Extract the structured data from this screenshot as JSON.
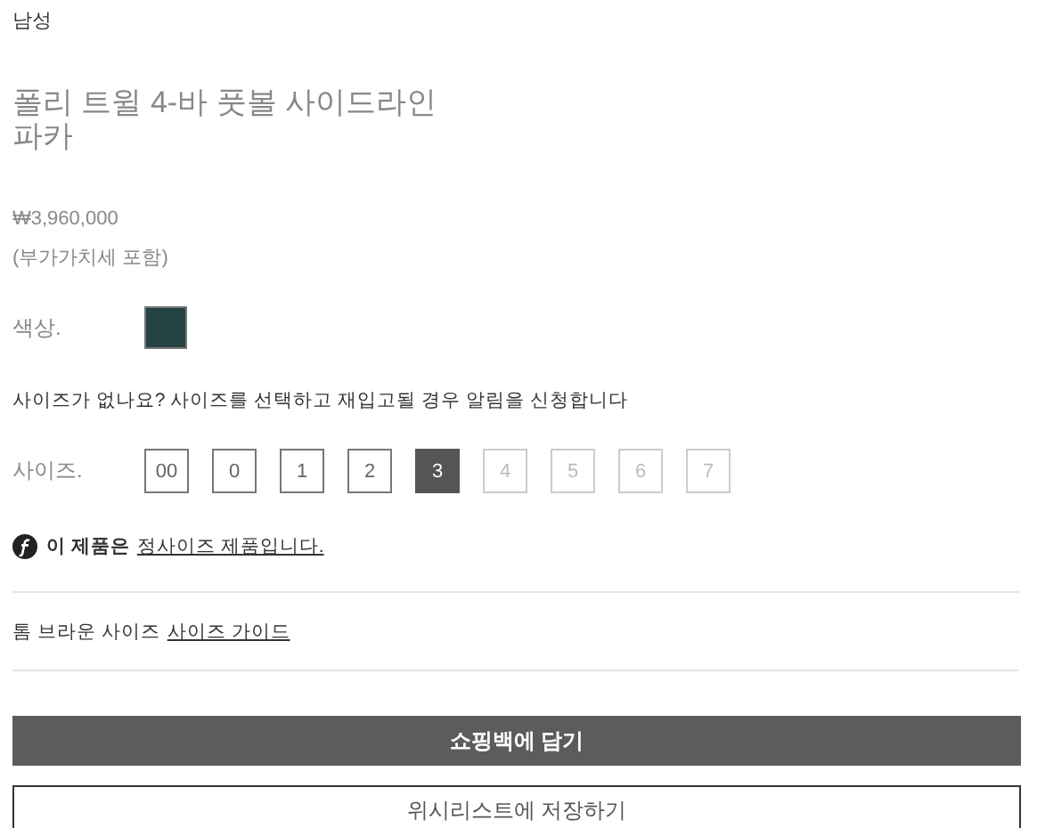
{
  "category": "남성",
  "title_lines": [
    "폴리 트윌 4-바 풋볼 사이드라인",
    "파카"
  ],
  "price": "₩3,960,000",
  "vat_note": "(부가가치세 포함)",
  "color": {
    "label": "색상.",
    "swatches": [
      {
        "color": "#244443",
        "selected": true
      }
    ]
  },
  "size_notice": "사이즈가 없나요? 사이즈를 선택하고 재입고될 경우 알림을 신청합니다",
  "size": {
    "label": "사이즈.",
    "options": [
      {
        "label": "00",
        "selected": false,
        "disabled": false
      },
      {
        "label": "0",
        "selected": false,
        "disabled": false
      },
      {
        "label": "1",
        "selected": false,
        "disabled": false
      },
      {
        "label": "2",
        "selected": false,
        "disabled": false
      },
      {
        "label": "3",
        "selected": true,
        "disabled": false
      },
      {
        "label": "4",
        "selected": false,
        "disabled": true
      },
      {
        "label": "5",
        "selected": false,
        "disabled": true
      },
      {
        "label": "6",
        "selected": false,
        "disabled": true
      },
      {
        "label": "7",
        "selected": false,
        "disabled": true
      }
    ]
  },
  "fit_info": {
    "text": "이 제품은",
    "link": "정사이즈 제품입니다."
  },
  "size_guide": {
    "text": "톰 브라운 사이즈",
    "link": "사이즈 가이드"
  },
  "buttons": [
    {
      "label": "쇼핑백에 담기",
      "kind": "primary"
    },
    {
      "label": "위시리스트에 저장하기",
      "kind": "secondary"
    }
  ]
}
